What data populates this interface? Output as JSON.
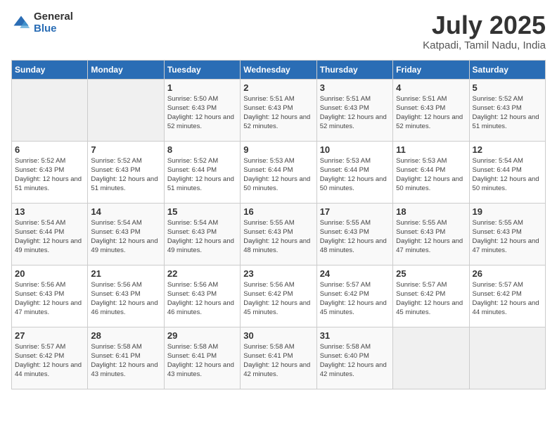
{
  "logo": {
    "general": "General",
    "blue": "Blue"
  },
  "title": "July 2025",
  "location": "Katpadi, Tamil Nadu, India",
  "days_of_week": [
    "Sunday",
    "Monday",
    "Tuesday",
    "Wednesday",
    "Thursday",
    "Friday",
    "Saturday"
  ],
  "weeks": [
    [
      {
        "num": "",
        "info": ""
      },
      {
        "num": "",
        "info": ""
      },
      {
        "num": "1",
        "info": "Sunrise: 5:50 AM\nSunset: 6:43 PM\nDaylight: 12 hours and 52 minutes."
      },
      {
        "num": "2",
        "info": "Sunrise: 5:51 AM\nSunset: 6:43 PM\nDaylight: 12 hours and 52 minutes."
      },
      {
        "num": "3",
        "info": "Sunrise: 5:51 AM\nSunset: 6:43 PM\nDaylight: 12 hours and 52 minutes."
      },
      {
        "num": "4",
        "info": "Sunrise: 5:51 AM\nSunset: 6:43 PM\nDaylight: 12 hours and 52 minutes."
      },
      {
        "num": "5",
        "info": "Sunrise: 5:52 AM\nSunset: 6:43 PM\nDaylight: 12 hours and 51 minutes."
      }
    ],
    [
      {
        "num": "6",
        "info": "Sunrise: 5:52 AM\nSunset: 6:43 PM\nDaylight: 12 hours and 51 minutes."
      },
      {
        "num": "7",
        "info": "Sunrise: 5:52 AM\nSunset: 6:43 PM\nDaylight: 12 hours and 51 minutes."
      },
      {
        "num": "8",
        "info": "Sunrise: 5:52 AM\nSunset: 6:44 PM\nDaylight: 12 hours and 51 minutes."
      },
      {
        "num": "9",
        "info": "Sunrise: 5:53 AM\nSunset: 6:44 PM\nDaylight: 12 hours and 50 minutes."
      },
      {
        "num": "10",
        "info": "Sunrise: 5:53 AM\nSunset: 6:44 PM\nDaylight: 12 hours and 50 minutes."
      },
      {
        "num": "11",
        "info": "Sunrise: 5:53 AM\nSunset: 6:44 PM\nDaylight: 12 hours and 50 minutes."
      },
      {
        "num": "12",
        "info": "Sunrise: 5:54 AM\nSunset: 6:44 PM\nDaylight: 12 hours and 50 minutes."
      }
    ],
    [
      {
        "num": "13",
        "info": "Sunrise: 5:54 AM\nSunset: 6:44 PM\nDaylight: 12 hours and 49 minutes."
      },
      {
        "num": "14",
        "info": "Sunrise: 5:54 AM\nSunset: 6:43 PM\nDaylight: 12 hours and 49 minutes."
      },
      {
        "num": "15",
        "info": "Sunrise: 5:54 AM\nSunset: 6:43 PM\nDaylight: 12 hours and 49 minutes."
      },
      {
        "num": "16",
        "info": "Sunrise: 5:55 AM\nSunset: 6:43 PM\nDaylight: 12 hours and 48 minutes."
      },
      {
        "num": "17",
        "info": "Sunrise: 5:55 AM\nSunset: 6:43 PM\nDaylight: 12 hours and 48 minutes."
      },
      {
        "num": "18",
        "info": "Sunrise: 5:55 AM\nSunset: 6:43 PM\nDaylight: 12 hours and 47 minutes."
      },
      {
        "num": "19",
        "info": "Sunrise: 5:55 AM\nSunset: 6:43 PM\nDaylight: 12 hours and 47 minutes."
      }
    ],
    [
      {
        "num": "20",
        "info": "Sunrise: 5:56 AM\nSunset: 6:43 PM\nDaylight: 12 hours and 47 minutes."
      },
      {
        "num": "21",
        "info": "Sunrise: 5:56 AM\nSunset: 6:43 PM\nDaylight: 12 hours and 46 minutes."
      },
      {
        "num": "22",
        "info": "Sunrise: 5:56 AM\nSunset: 6:43 PM\nDaylight: 12 hours and 46 minutes."
      },
      {
        "num": "23",
        "info": "Sunrise: 5:56 AM\nSunset: 6:42 PM\nDaylight: 12 hours and 45 minutes."
      },
      {
        "num": "24",
        "info": "Sunrise: 5:57 AM\nSunset: 6:42 PM\nDaylight: 12 hours and 45 minutes."
      },
      {
        "num": "25",
        "info": "Sunrise: 5:57 AM\nSunset: 6:42 PM\nDaylight: 12 hours and 45 minutes."
      },
      {
        "num": "26",
        "info": "Sunrise: 5:57 AM\nSunset: 6:42 PM\nDaylight: 12 hours and 44 minutes."
      }
    ],
    [
      {
        "num": "27",
        "info": "Sunrise: 5:57 AM\nSunset: 6:42 PM\nDaylight: 12 hours and 44 minutes."
      },
      {
        "num": "28",
        "info": "Sunrise: 5:58 AM\nSunset: 6:41 PM\nDaylight: 12 hours and 43 minutes."
      },
      {
        "num": "29",
        "info": "Sunrise: 5:58 AM\nSunset: 6:41 PM\nDaylight: 12 hours and 43 minutes."
      },
      {
        "num": "30",
        "info": "Sunrise: 5:58 AM\nSunset: 6:41 PM\nDaylight: 12 hours and 42 minutes."
      },
      {
        "num": "31",
        "info": "Sunrise: 5:58 AM\nSunset: 6:40 PM\nDaylight: 12 hours and 42 minutes."
      },
      {
        "num": "",
        "info": ""
      },
      {
        "num": "",
        "info": ""
      }
    ]
  ]
}
